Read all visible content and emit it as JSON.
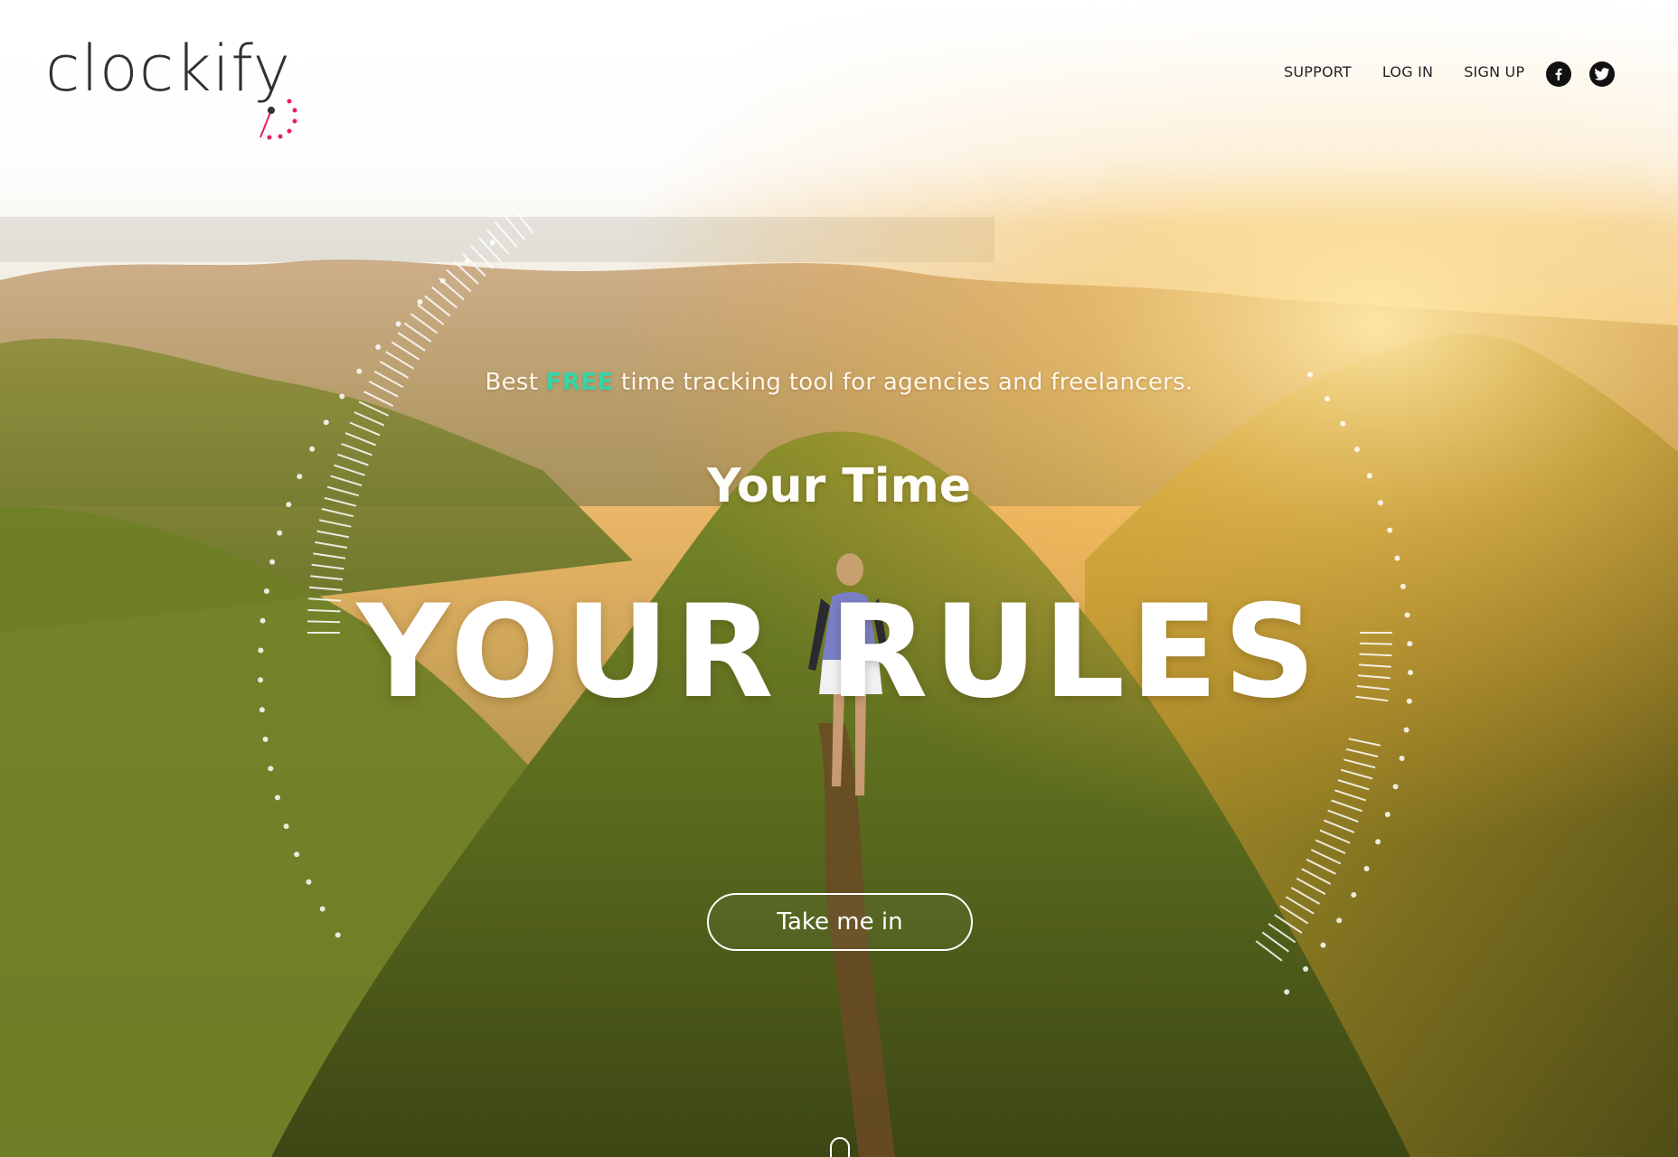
{
  "brand": {
    "logo_text": "clockify",
    "accent_color": "#e91e63"
  },
  "nav": {
    "support": "SUPPORT",
    "login": "LOG IN",
    "signup": "SIGN UP",
    "social_icons": [
      "facebook-icon",
      "twitter-icon"
    ]
  },
  "hero": {
    "tagline_prefix": "Best ",
    "tagline_highlight": "FREE",
    "tagline_suffix": " time tracking tool for agencies and freelancers.",
    "headline_small": "Your Time",
    "headline_big": "YOUR RULES",
    "cta_label": "Take me in",
    "highlight_color": "#36d4a8"
  }
}
